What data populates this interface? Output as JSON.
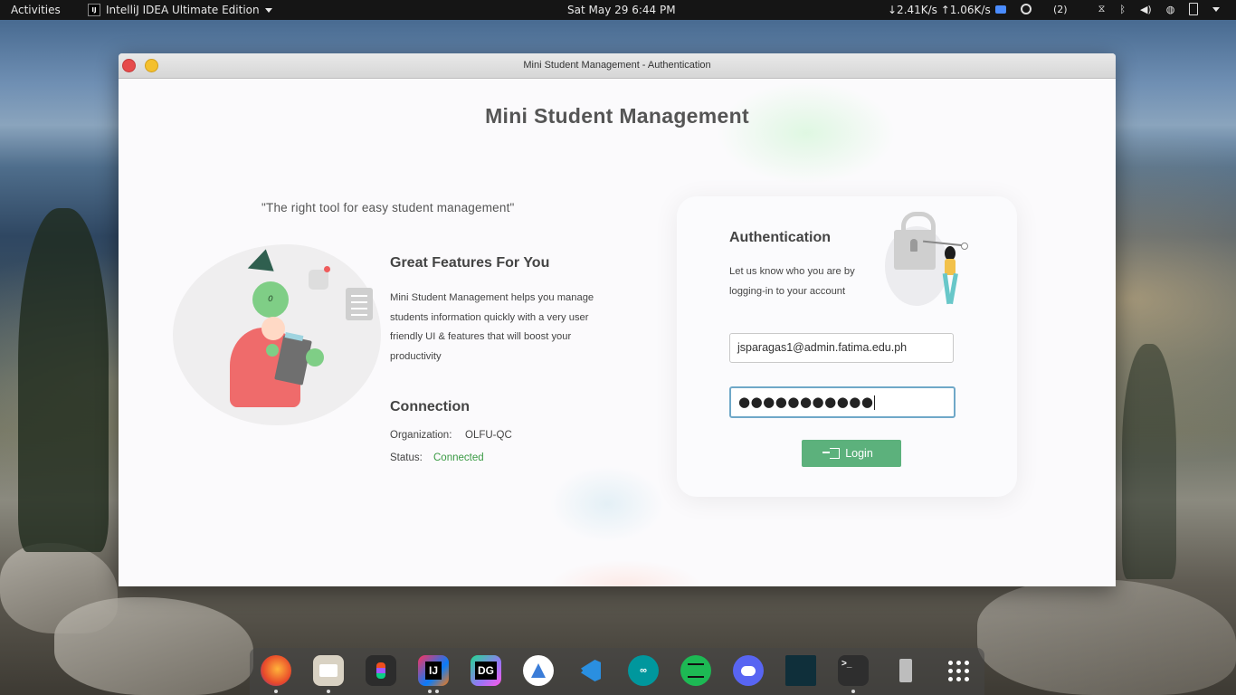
{
  "topbar": {
    "activities": "Activities",
    "app_name": "IntelliJ IDEA Ultimate Edition",
    "datetime": "Sat May 29   6:44 PM",
    "net_speed": "↓2.41K/s ↑1.06K/s",
    "notif_count": "(2)"
  },
  "window": {
    "title": "Mini Student Management - Authentication"
  },
  "main": {
    "app_title": "Mini Student Management",
    "tagline": "\"The right tool for easy student management\"",
    "illustration_circle_text": "0"
  },
  "features": {
    "title": "Great Features For You",
    "description": "Mini Student Management helps you manage students information quickly with a very user friendly UI & features that will boost your productivity"
  },
  "connection": {
    "title": "Connection",
    "org_label": "Organization:",
    "org_value": "OLFU-QC",
    "status_label": "Status:",
    "status_value": "Connected",
    "status_color": "#3a9a44"
  },
  "auth": {
    "title": "Authentication",
    "description": "Let us know who you are by logging-in to your account",
    "email_value": "jsparagas1@admin.fatima.edu.ph",
    "password_masked": "●●●●●●●●●●●",
    "login_label": "Login",
    "accent_color": "#5cb17c"
  },
  "dock": {
    "items": [
      {
        "icon": "firefox-icon",
        "label": ""
      },
      {
        "icon": "files-icon",
        "label": ""
      },
      {
        "icon": "figma-icon",
        "label": ""
      },
      {
        "icon": "intellij-icon",
        "label": "IJ"
      },
      {
        "icon": "datagrip-icon",
        "label": "DG"
      },
      {
        "icon": "android-studio-icon",
        "label": ""
      },
      {
        "icon": "vscode-icon",
        "label": ""
      },
      {
        "icon": "arduino-icon",
        "label": ""
      },
      {
        "icon": "spotify-icon",
        "label": ""
      },
      {
        "icon": "discord-icon",
        "label": ""
      },
      {
        "icon": "terminal-alt-icon",
        "label": ""
      },
      {
        "icon": "terminal-icon",
        "label": ">_"
      },
      {
        "icon": "usb-drive-icon",
        "label": ""
      },
      {
        "icon": "app-grid-icon",
        "label": ""
      }
    ]
  }
}
